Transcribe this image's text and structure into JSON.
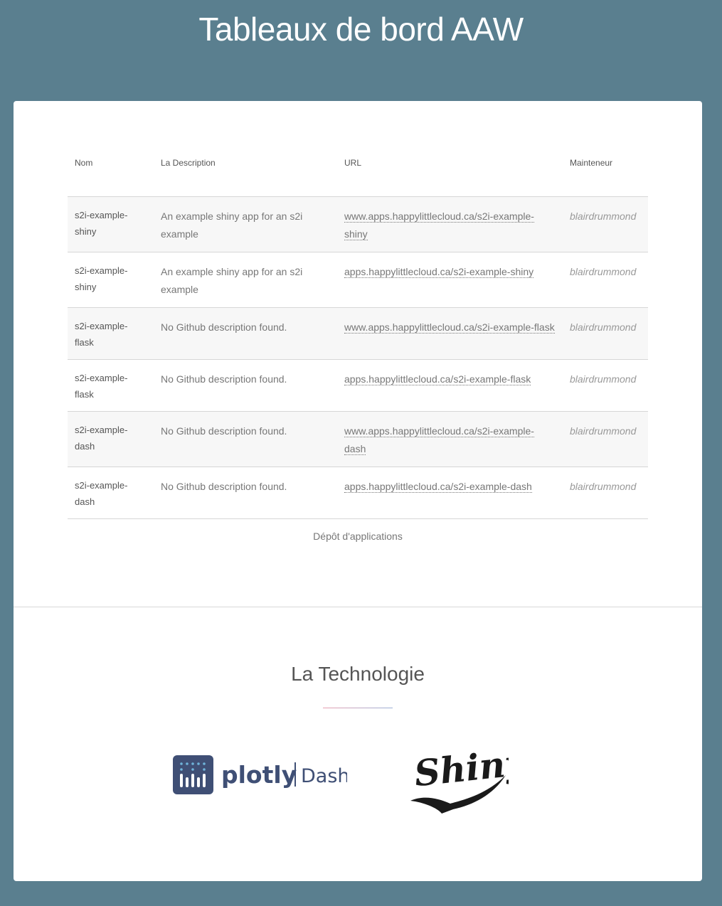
{
  "header": {
    "title": "Tableaux de bord AAW"
  },
  "table": {
    "columns": [
      "Nom",
      "La Description",
      "URL",
      "Mainteneur"
    ],
    "rows": [
      {
        "name": "s2i-example-shiny",
        "description": "An example shiny app for an s2i example",
        "url": "www.apps.happylittlecloud.ca/s2i-example-shiny",
        "maintainer": "blairdrummond"
      },
      {
        "name": "s2i-example-shiny",
        "description": "An example shiny app for an s2i example",
        "url": "apps.happylittlecloud.ca/s2i-example-shiny",
        "maintainer": "blairdrummond"
      },
      {
        "name": "s2i-example-flask",
        "description": "No Github description found.",
        "url": "www.apps.happylittlecloud.ca/s2i-example-flask",
        "maintainer": "blairdrummond"
      },
      {
        "name": "s2i-example-flask",
        "description": "No Github description found.",
        "url": "apps.happylittlecloud.ca/s2i-example-flask",
        "maintainer": "blairdrummond"
      },
      {
        "name": "s2i-example-dash",
        "description": "No Github description found.",
        "url": "www.apps.happylittlecloud.ca/s2i-example-dash",
        "maintainer": "blairdrummond"
      },
      {
        "name": "s2i-example-dash",
        "description": "No Github description found.",
        "url": "apps.happylittlecloud.ca/s2i-example-dash",
        "maintainer": "blairdrummond"
      }
    ]
  },
  "repo_link": "Dépôt d'applications",
  "technology": {
    "title": "La Technologie",
    "logos": [
      {
        "icon": "plotly-dash-logo",
        "brand": "plotly",
        "product": "Dash",
        "color": "#3f4f75"
      },
      {
        "icon": "shiny-logo",
        "text": "Shiny",
        "color": "#1a1a1a"
      }
    ]
  },
  "colors": {
    "background": "#5a7f8f",
    "card": "#ffffff",
    "row_stripe": "#f7f7f7"
  }
}
